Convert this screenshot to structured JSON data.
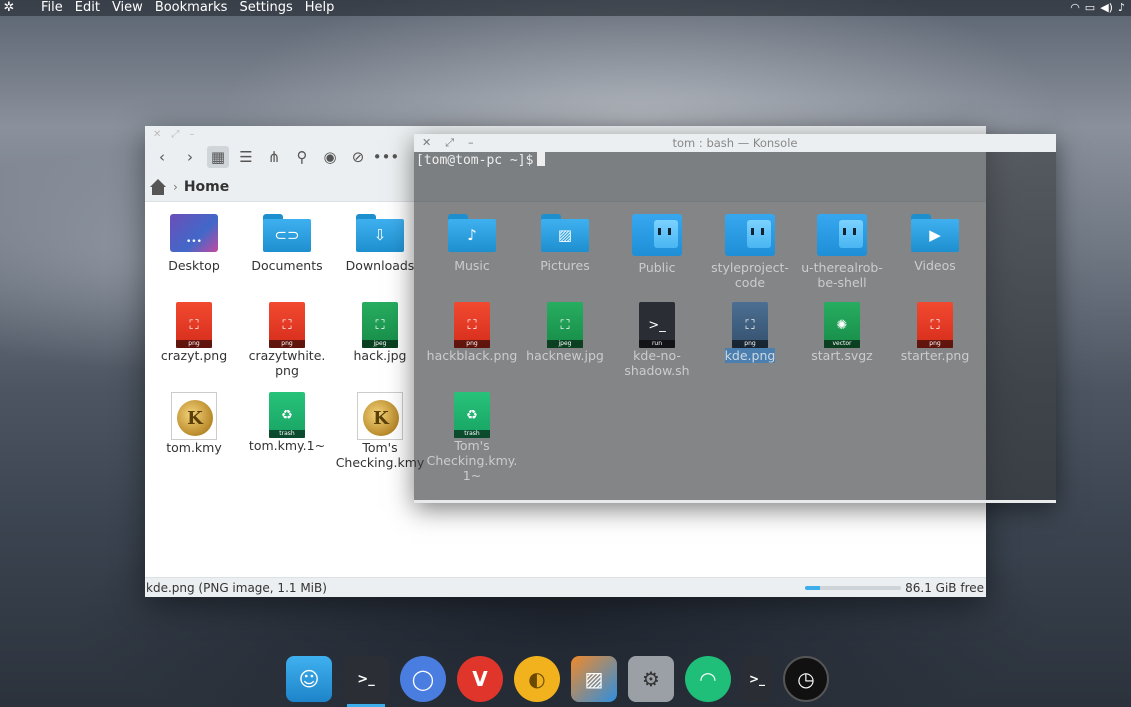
{
  "menubar": {
    "items": [
      "File",
      "Edit",
      "View",
      "Bookmarks",
      "Settings",
      "Help"
    ],
    "tray": [
      "wifi-icon",
      "battery-icon",
      "volume-icon",
      "bell-icon"
    ]
  },
  "dolphin": {
    "breadcrumb": {
      "current": "Home"
    },
    "status_text": "kde.png (PNG image, 1.1 MiB)",
    "free_space": "86.1 GiB free",
    "free_space_used_fraction": 0.15,
    "files": [
      {
        "name": "Desktop",
        "kind": "desktop"
      },
      {
        "name": "Documents",
        "kind": "folder",
        "icon": "paperclip"
      },
      {
        "name": "Downloads",
        "kind": "folder",
        "icon": "download"
      },
      {
        "name": "crazyt.png",
        "kind": "png"
      },
      {
        "name": "crazytwhite.\npng",
        "kind": "png"
      },
      {
        "name": "hack.jpg",
        "kind": "jpeg"
      },
      {
        "name": "tom.kmy",
        "kind": "kmy"
      },
      {
        "name": "tom.kmy.1~",
        "kind": "trash"
      },
      {
        "name": "Tom's\nChecking.kmy",
        "kind": "kmy"
      }
    ]
  },
  "konsole": {
    "title": "tom : bash — Konsole",
    "prompt": "[tom@tom-pc ~]$",
    "files": [
      {
        "name": "Music",
        "kind": "folder",
        "icon": "music"
      },
      {
        "name": "Pictures",
        "kind": "folder",
        "icon": "picture"
      },
      {
        "name": "Public",
        "kind": "finder"
      },
      {
        "name": "styleproject-\ncode",
        "kind": "finder"
      },
      {
        "name": "u-therealrob-\nbe-shell",
        "kind": "finder"
      },
      {
        "name": "Videos",
        "kind": "folder",
        "icon": "video"
      },
      {
        "name": "hackblack.png",
        "kind": "png"
      },
      {
        "name": "hacknew.jpg",
        "kind": "jpeg"
      },
      {
        "name": "kde-no-\nshadow.sh",
        "kind": "run"
      },
      {
        "name": "kde.png",
        "kind": "png-selected"
      },
      {
        "name": "start.svgz",
        "kind": "vector"
      },
      {
        "name": "starter.png",
        "kind": "png"
      },
      {
        "name": "Tom's\nChecking.kmy.\n1~",
        "kind": "trash"
      }
    ],
    "tags": {
      "png": "png",
      "jpeg": "jpeg",
      "run": "run",
      "vector": "vector",
      "trash": "trash"
    }
  },
  "dock": {
    "apps": [
      "finder-icon",
      "terminal-icon",
      "chromium-icon",
      "vivaldi-icon",
      "piggy-bank-icon",
      "image-viewer-icon",
      "system-settings-icon",
      "ghost-icon",
      "run-terminal-icon",
      "clock-icon"
    ]
  },
  "colors": {
    "accent": "#3daee9",
    "png_red": "#e63a25",
    "jpeg_green": "#1f9e53",
    "folder_blue": "#2a9ee0"
  }
}
